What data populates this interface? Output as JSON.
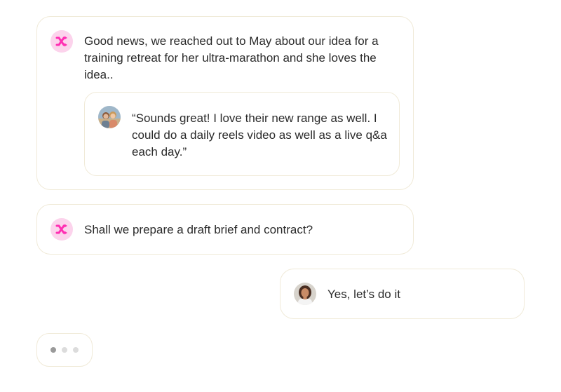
{
  "colors": {
    "brand_pink": "#ff2fb3",
    "brand_bg": "#fcd3ec",
    "card_border": "#f0ead8",
    "text": "#2b2b2b"
  },
  "messages": [
    {
      "sender": "brand",
      "avatar_icon": "shuffle-brand-icon",
      "text": "Good news, we reached out to May about our idea for a training retreat for her ultra-marathon and she loves the idea..",
      "quote": {
        "avatar_icon": "person-avatar",
        "text": "“Sounds great! I love their new range as well. I could do a daily reels video as well as a live q&a each day.”"
      }
    },
    {
      "sender": "brand",
      "avatar_icon": "shuffle-brand-icon",
      "text": "Shall we prepare a draft brief and contract?"
    },
    {
      "sender": "user",
      "avatar_icon": "user-avatar",
      "text": "Yes, let’s do it"
    }
  ],
  "typing_indicator": {
    "dots": 3,
    "active_dot": 1
  }
}
